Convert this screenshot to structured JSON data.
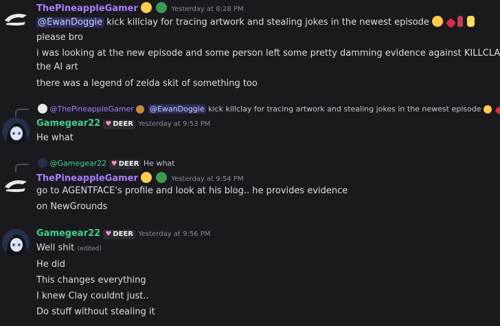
{
  "messages": [
    {
      "author": "ThePineappleGamer",
      "timestamp": "Yesterday at 8:28 PM",
      "mention": "@EwanDoggie",
      "line1_rest": "kick killclay for tracing artwork and stealing jokes in the newest episode",
      "lines": [
        "please bro",
        "i was looking at the new episode and some person left some pretty damming evidence against KILLCLAY and",
        "the AI art",
        "there was a legend of zelda skit of something too"
      ]
    },
    {
      "reply_author": "@ThePineappleGamer",
      "reply_mention": "@EwanDoggie",
      "reply_text": "kick killclay for tracing artwork and stealing jokes in the newest episode",
      "author": "Gamegear22",
      "tag": "DEER",
      "timestamp": "Yesterday at 9:53 PM",
      "lines": [
        "He what"
      ]
    },
    {
      "reply_author": "@Gamegear22",
      "reply_tag": "DEER",
      "reply_text": "He what",
      "author": "ThePineappleGamer",
      "timestamp": "Yesterday at 9:54 PM",
      "lines": [
        "go to AGENTFACE's profile and look at his blog.. he provides evidence",
        "on NewGrounds"
      ]
    },
    {
      "author": "Gamegear22",
      "tag": "DEER",
      "timestamp": "Yesterday at 9:56 PM",
      "first_line": "Well shit",
      "edited": "(edited)",
      "lines": [
        "He did",
        "This changes everything",
        "I knew Clay couldnt just..",
        "Do stuff without stealing it"
      ]
    }
  ],
  "colors": {
    "background": "#1a1a1e",
    "pineapple_name": "#a97fff",
    "gamegear_name": "#45d08f",
    "mention_bg": "#3a3f7a"
  }
}
